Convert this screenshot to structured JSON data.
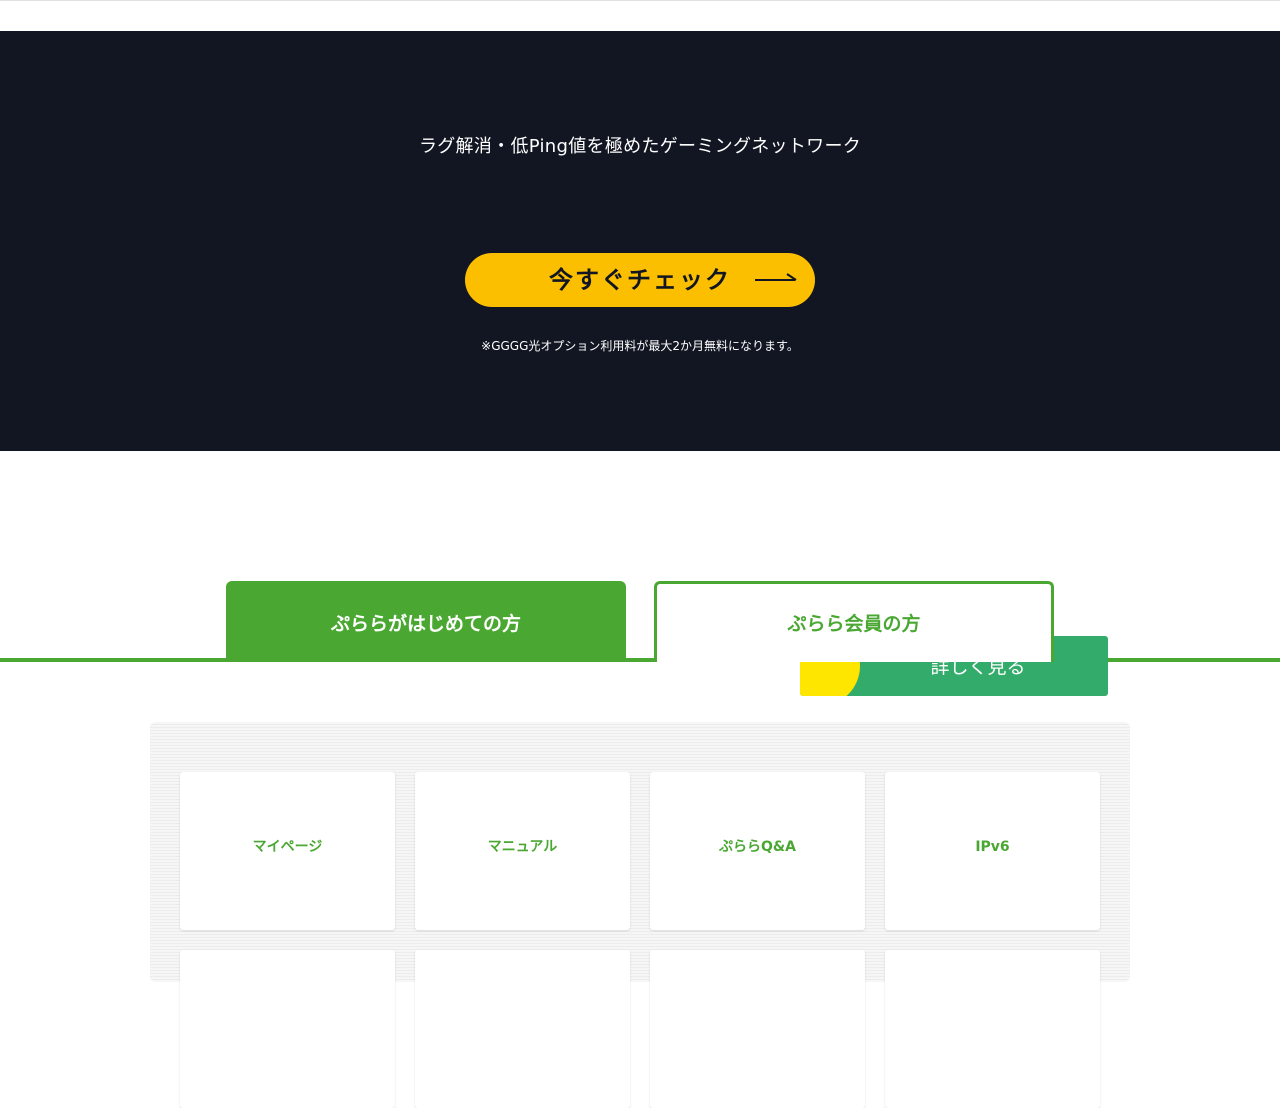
{
  "hero": {
    "tagline": "ラグ解消・低Ping値を極めたゲーミングネットワーク",
    "cta_label": "今すぐチェック",
    "note": "※GGGG光オプション利用料が最大2か月無料になります。"
  },
  "tabs": [
    {
      "label": "ぷららがはじめての方"
    },
    {
      "label": "ぷらら会員の方"
    }
  ],
  "promo": {
    "label": "詳しく見る"
  },
  "menu": {
    "items": [
      {
        "label": "マイページ"
      },
      {
        "label": "マニュアル"
      },
      {
        "label": "ぷららQ&A"
      },
      {
        "label": "IPv6"
      },
      {
        "label": ""
      },
      {
        "label": ""
      },
      {
        "label": ""
      },
      {
        "label": ""
      }
    ]
  },
  "colors": {
    "hero_bg": "#111622",
    "cta": "#fbbf00",
    "brand_green": "#4aa832",
    "promo_green": "#33ac6b",
    "promo_yellow": "#ffe600"
  },
  "icons": {
    "cta_arrow": "long-right-arrow-icon"
  }
}
